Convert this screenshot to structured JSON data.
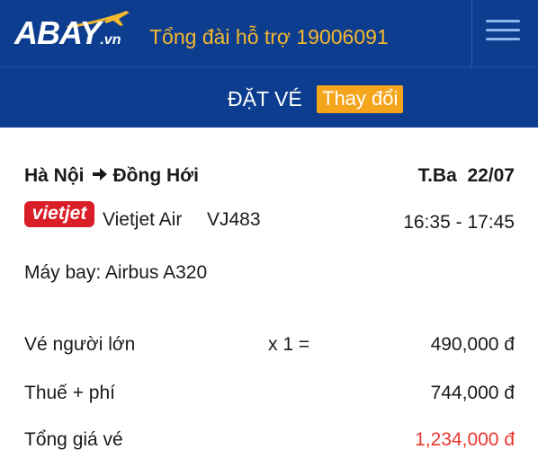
{
  "header": {
    "logo_text": "ABAY",
    "logo_suffix": ".vn",
    "hotline": "Tổng đài hỗ trợ 19006091",
    "icons": {
      "logo_plane": "airplane-icon",
      "menu": "hamburger-menu-icon"
    }
  },
  "band": {
    "title": "ĐẶT VÉ",
    "change_label": "Thay đổi"
  },
  "flight": {
    "origin": "Hà Nội",
    "destination": "Đồng Hới",
    "route_arrow_icon": "arrow-right-icon",
    "day": "T.Ba",
    "date": "22/07",
    "airline_logo_text": "vietjet",
    "airline": "Vietjet Air",
    "flight_number": "VJ483",
    "depart_time": "16:35",
    "arrive_time": "17:45",
    "time_separator": " - ",
    "aircraft": "Máy bay: Airbus A320"
  },
  "pricing": {
    "rows": [
      {
        "label": "Vé người lớn",
        "qty": "x 1 =",
        "amount": "490,000 đ"
      },
      {
        "label": "Thuế + phí",
        "qty": "",
        "amount": "744,000 đ"
      },
      {
        "label": "Tổng giá vé",
        "qty": "",
        "amount": "1,234,000 đ"
      }
    ]
  },
  "colors": {
    "header_bg": "#0d3d8f",
    "hotline": "#f5b82e",
    "change_button": "#f5a51c",
    "airline_logo": "#d91e28",
    "total": "#e8372f"
  }
}
